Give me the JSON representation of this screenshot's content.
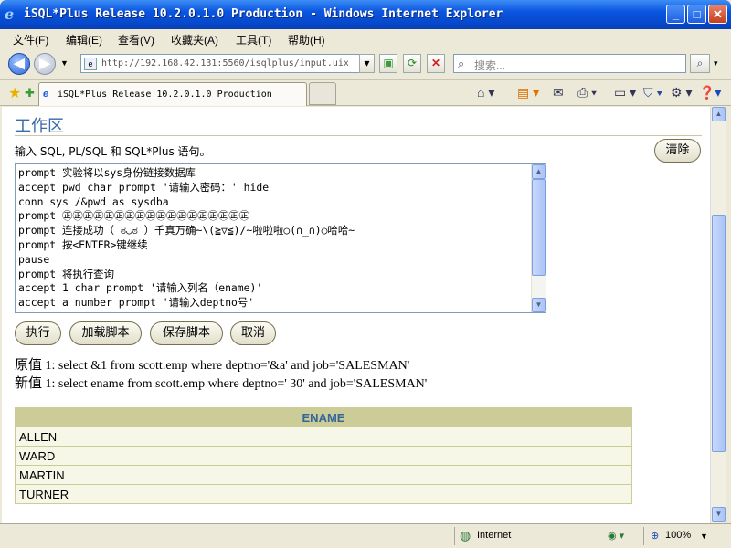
{
  "window": {
    "title": "iSQL*Plus Release 10.2.0.1.0 Production - Windows Internet Explorer",
    "minimize": "_",
    "maximize": "□",
    "close": "✕"
  },
  "menu": [
    "文件(F)",
    "编辑(E)",
    "查看(V)",
    "收藏夹(A)",
    "工具(T)",
    "帮助(H)"
  ],
  "address": {
    "url": "http://192.168.42.131:5560/isqlplus/input.uix?;"
  },
  "search": {
    "placeholder": "搜索..."
  },
  "tab": {
    "title": "iSQL*Plus Release 10.2.0.1.0 Production"
  },
  "workarea": {
    "title": "工作区",
    "prompt_label": "输入 SQL, PL/SQL 和 SQL*Plus 语句。",
    "clear_label": "清除",
    "script": "prompt 实验将以sys身份链接数据库\naccept pwd char prompt '请输入密码：' hide\nconn sys /&pwd as sysdba\nprompt ㊣㊣㊣㊣㊣㊣㊣㊣㊣㊣㊣㊣㊣㊣㊣㊣㊣㊣\nprompt 连接成功（ ಠ◡ಠ ）千真万确~\\(≧▽≦)/~啦啦啦○(∩_∩)○哈哈~\nprompt 按<ENTER>键继续\npause\nprompt 将执行查询\naccept 1 char prompt '请输入列名（ename)'\naccept a number prompt '请输入deptno号'",
    "buttons": {
      "execute": "执行",
      "load": "加载脚本",
      "save": "保存脚本",
      "cancel": "取消"
    }
  },
  "substitution": {
    "old_label": "原值",
    "old_text": "1: select &1 from scott.emp where deptno='&a' and job='SALESMAN'",
    "new_label": "新值",
    "new_text": "1: select ename from scott.emp where deptno=' 30' and job='SALESMAN'"
  },
  "results": {
    "header": "ENAME",
    "rows": [
      "ALLEN",
      "WARD",
      "MARTIN",
      "TURNER"
    ]
  },
  "status": {
    "zone": "Internet",
    "zoom": "100%"
  },
  "icons": {
    "back": "back-arrow-icon",
    "forward": "forward-arrow-icon",
    "refresh": "refresh-icon",
    "stop": "stop-icon",
    "home": "home-icon",
    "rss": "rss-icon",
    "print": "print-icon",
    "favorites": "star-icon"
  },
  "colors": {
    "title_bar": "#0a55e0",
    "heading": "#3a6aa8",
    "table_header": "#cccc99",
    "table_header_text": "#336699",
    "table_row": "#f7f7e7"
  }
}
